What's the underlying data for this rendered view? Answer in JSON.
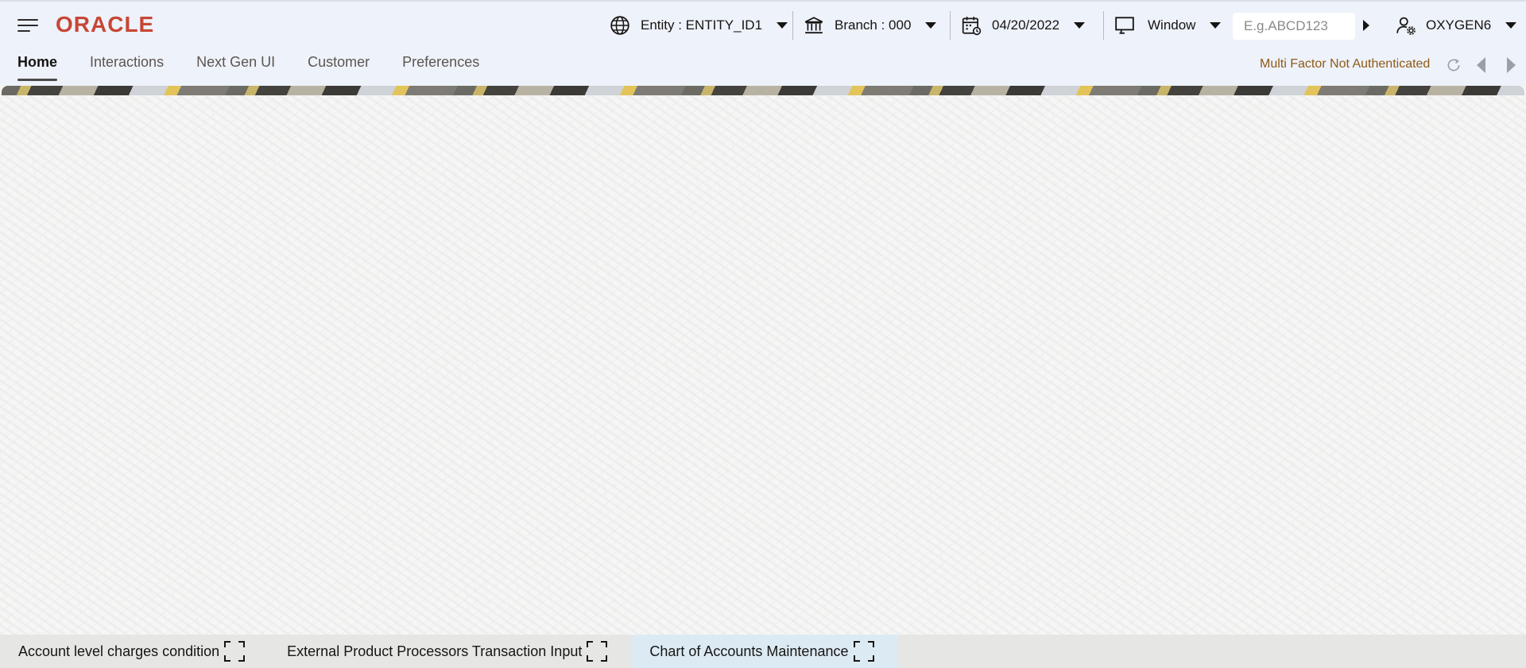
{
  "brand": {
    "logo_text": "ORACLE",
    "logo_color": "#c74634"
  },
  "topbar": {
    "entity": {
      "label": "Entity : ENTITY_ID1",
      "icon": "globe-icon"
    },
    "branch": {
      "label": "Branch : 000",
      "icon": "bank-icon"
    },
    "date": {
      "label": "04/20/2022",
      "icon": "calendar-icon"
    },
    "window": {
      "label": "Window",
      "icon": "monitor-icon"
    },
    "search": {
      "placeholder": "E.g.ABCD123",
      "value": ""
    },
    "user": {
      "label": "OXYGEN6",
      "icon": "user-settings-icon"
    }
  },
  "tabs": [
    {
      "label": "Home",
      "active": true
    },
    {
      "label": "Interactions",
      "active": false
    },
    {
      "label": "Next Gen UI",
      "active": false
    },
    {
      "label": "Customer",
      "active": false
    },
    {
      "label": "Preferences",
      "active": false
    }
  ],
  "status": {
    "mfa_text": "Multi Factor Not Authenticated",
    "mfa_color": "#8f5a18"
  },
  "taskbar": [
    {
      "label": "Account level charges condition",
      "active": false
    },
    {
      "label": "External Product Processors Transaction Input",
      "active": false
    },
    {
      "label": "Chart of Accounts Maintenance",
      "active": true
    }
  ]
}
